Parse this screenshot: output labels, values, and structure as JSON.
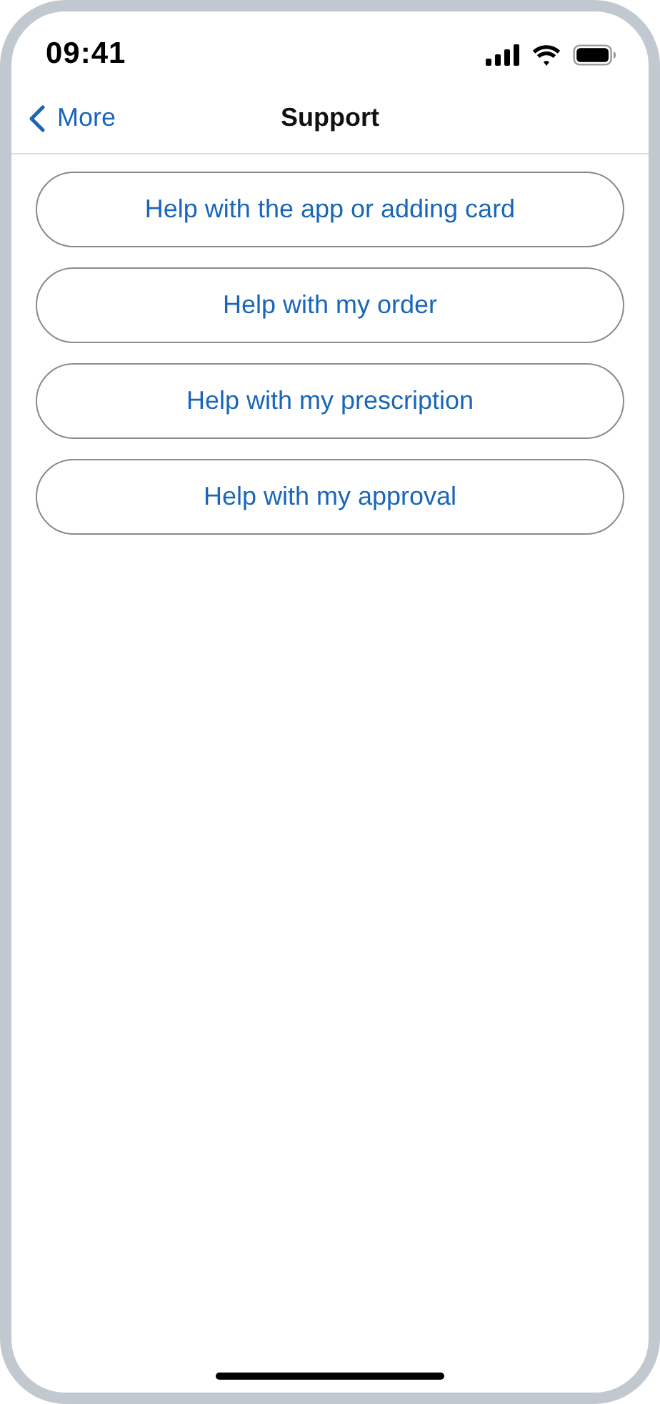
{
  "status_bar": {
    "time": "09:41"
  },
  "nav_bar": {
    "back_label": "More",
    "title": "Support"
  },
  "options": [
    {
      "label": "Help with the app or adding card"
    },
    {
      "label": "Help with my order"
    },
    {
      "label": "Help with my prescription"
    },
    {
      "label": "Help with my approval"
    }
  ]
}
